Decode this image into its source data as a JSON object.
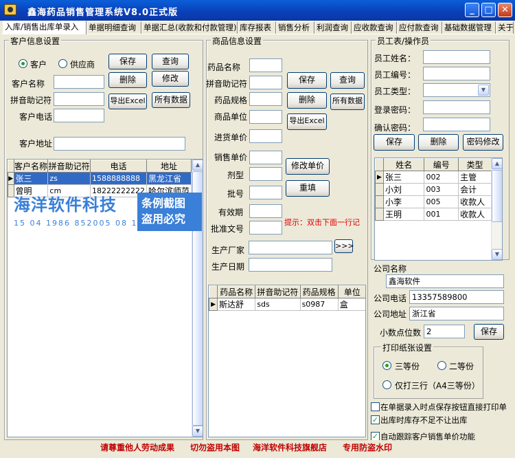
{
  "window": {
    "title": "鑫海药品销售管理系统V8.0正式版",
    "min_label": "_",
    "max_label": "□",
    "close_label": "✕"
  },
  "tabs": [
    {
      "label": "入库/销售出库单录入"
    },
    {
      "label": "单据明细查询"
    },
    {
      "label": "单据汇总(收款和付款管理)"
    },
    {
      "label": "库存报表"
    },
    {
      "label": "销售分析"
    },
    {
      "label": "利润查询"
    },
    {
      "label": "应收款查询"
    },
    {
      "label": "应付款查询"
    },
    {
      "label": "基础数据管理"
    },
    {
      "label": "关于"
    }
  ],
  "customer": {
    "group_title": "客户信息设置",
    "radio_customer": "客户",
    "radio_supplier": "供应商",
    "name_label": "客户名称",
    "pinyin_label": "拼音助记符",
    "phone_label": "客户电话",
    "address_label": "客户地址",
    "btn_save": "保存",
    "btn_query": "查询",
    "btn_delete": "删除",
    "btn_modify": "修改",
    "btn_export": "导出Excel",
    "btn_all": "所有数据",
    "columns": [
      "客户名称",
      "拼音助记符",
      "电话",
      "地址"
    ],
    "rows": [
      {
        "name": "张三",
        "pinyin": "zs",
        "phone": "1588888888",
        "address": "黑龙江省"
      },
      {
        "name": "曾明",
        "pinyin": "cm",
        "phone": "18222222222",
        "address": "哈尔滨师范"
      }
    ]
  },
  "watermark": {
    "brand": "海洋软件科技",
    "digits": "15 04 1986 852005 08 10",
    "stamp1": "条例截图",
    "stamp2": "盗用必究"
  },
  "drug": {
    "group_title": "商品信息设置",
    "name_label": "药品名称",
    "pinyin_label": "拼音助记符",
    "spec_label": "药品规格",
    "unit_label": "商品单位",
    "buy_price_label": "进货单价",
    "sell_price_label": "销售单价",
    "form_label": "剂型",
    "batch_label": "批号",
    "expiry_label": "有效期",
    "approval_label": "批准文号",
    "maker_label": "生产厂家",
    "date_label": "生产日期",
    "btn_save": "保存",
    "btn_query": "查询",
    "btn_delete": "删除",
    "btn_all": "所有数据",
    "btn_export": "导出Excel",
    "btn_modify_price": "修改单价",
    "btn_reset": "重填",
    "btn_more": ">>>",
    "hint": "提示：双击下面一行记",
    "columns": [
      "药品名称",
      "拼音助记符",
      "药品规格",
      "单位"
    ],
    "rows": [
      {
        "name": "斯达舒",
        "pinyin": "sds",
        "spec": "s0987",
        "unit": "盒"
      }
    ]
  },
  "staff": {
    "group_title": "员工表/操作员",
    "name_label": "员工姓名：",
    "id_label": "员工编号：",
    "type_label": "员工类型：",
    "password_label": "登录密码：",
    "confirm_label": "确认密码：",
    "btn_save": "保存",
    "btn_delete": "删除",
    "btn_change_pw": "密码修改",
    "columns": [
      "姓名",
      "编号",
      "类型"
    ],
    "rows": [
      {
        "name": "张三",
        "id": "002",
        "type": "主管"
      },
      {
        "name": "小刘",
        "id": "003",
        "type": "会计"
      },
      {
        "name": "小李",
        "id": "005",
        "type": "收款人"
      },
      {
        "name": "王明",
        "id": "001",
        "type": "收款人"
      }
    ]
  },
  "company": {
    "name_label": "公司名称",
    "name_value": "鑫海软件",
    "phone_label": "公司电话",
    "phone_value": "13357589800",
    "address_label": "公司地址",
    "address_value": "浙江省",
    "decimals_label": "小数点位数",
    "decimals_value": "2",
    "btn_save": "保存"
  },
  "print": {
    "group_title": "打印纸张设置",
    "opt_three": "三等份",
    "opt_two": "二等份",
    "opt_only_three": "仅打三行（A4三等份）"
  },
  "options": {
    "opt1": "在单据录入时点保存按钮直接打印单",
    "opt2": "出库时库存不足不让出库",
    "opt3": "自动跟踪客户销售单价功能"
  },
  "footer": {
    "p1": "请尊重他人劳动成果",
    "p2": "切勿盗用本图",
    "p3": "海洋软件科技旗舰店",
    "p4": "专用防盗水印"
  }
}
